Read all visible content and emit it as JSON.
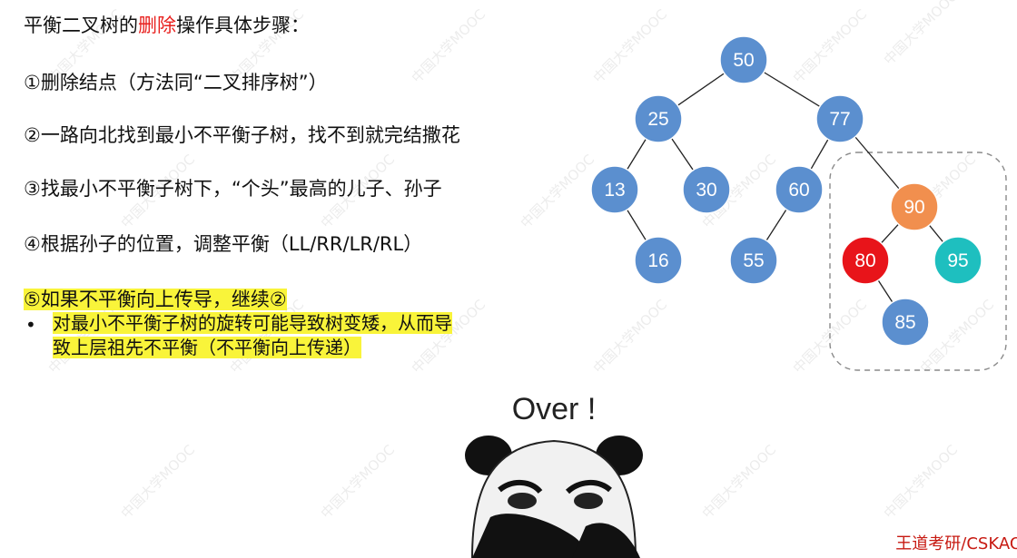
{
  "title": {
    "before": "平衡二叉树的",
    "highlight": "删除",
    "after": "操作具体步骤："
  },
  "steps": [
    "①删除结点（方法同“二叉排序树”）",
    "②一路向北找到最小不平衡子树，找不到就完结撒花",
    "③找最小不平衡子树下，“个头”最高的儿子、孙子",
    "④根据孙子的位置，调整平衡（LL/RR/LR/RL）"
  ],
  "step5": "⑤如果不平衡向上传导，继续②",
  "bullet": {
    "symbol": "•",
    "line1": "对最小不平衡子树的旋转可能导致树变矮，从而导",
    "line2": "致上层祖先不平衡（不平衡向上传递）"
  },
  "tree": {
    "nodes": [
      {
        "id": "n50",
        "label": "50",
        "color": "#5b8fcf"
      },
      {
        "id": "n25",
        "label": "25",
        "color": "#5b8fcf"
      },
      {
        "id": "n77",
        "label": "77",
        "color": "#5b8fcf"
      },
      {
        "id": "n13",
        "label": "13",
        "color": "#5b8fcf"
      },
      {
        "id": "n30",
        "label": "30",
        "color": "#5b8fcf"
      },
      {
        "id": "n60",
        "label": "60",
        "color": "#5b8fcf"
      },
      {
        "id": "n90",
        "label": "90",
        "color": "#f18f4e"
      },
      {
        "id": "n16",
        "label": "16",
        "color": "#5b8fcf"
      },
      {
        "id": "n55",
        "label": "55",
        "color": "#5b8fcf"
      },
      {
        "id": "n80",
        "label": "80",
        "color": "#e8141a"
      },
      {
        "id": "n95",
        "label": "95",
        "color": "#1ebfbf"
      },
      {
        "id": "n85",
        "label": "85",
        "color": "#5b8fcf"
      }
    ],
    "edges": [
      [
        "n50",
        "n25"
      ],
      [
        "n50",
        "n77"
      ],
      [
        "n25",
        "n13"
      ],
      [
        "n25",
        "n30"
      ],
      [
        "n77",
        "n60"
      ],
      [
        "n77",
        "n90"
      ],
      [
        "n13",
        "n16"
      ],
      [
        "n60",
        "n55"
      ],
      [
        "n90",
        "n80"
      ],
      [
        "n90",
        "n95"
      ],
      [
        "n80",
        "n85"
      ]
    ]
  },
  "meme_caption": "Over !",
  "footer": "王道考研/CSKAO",
  "watermark": "中国大学MOOC"
}
